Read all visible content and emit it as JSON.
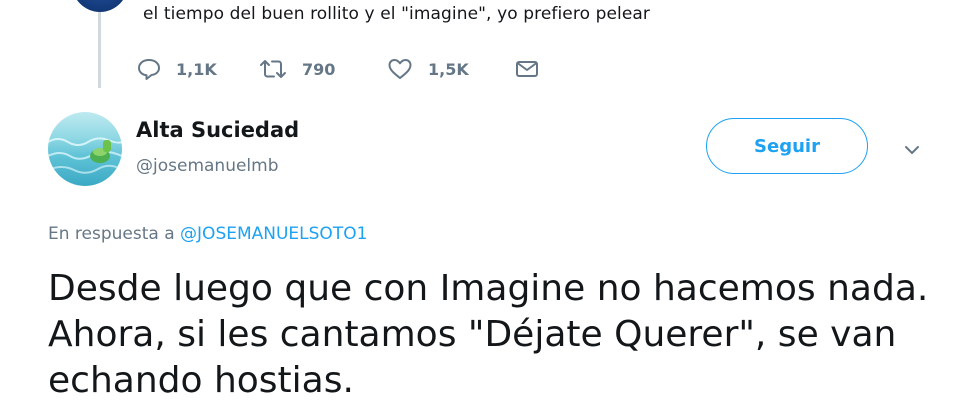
{
  "previous_tweet": {
    "text": "el tiempo del buen rollito y el \"imagine\", yo prefiero pelear",
    "actions": {
      "reply_count": "1,1K",
      "retweet_count": "790",
      "like_count": "1,5K"
    },
    "icons": [
      "reply-icon",
      "retweet-icon",
      "like-icon",
      "message-icon"
    ]
  },
  "tweet": {
    "author_name": "Alta Suciedad",
    "author_handle": "@josemanuelmb",
    "follow_label": "Seguir",
    "reply_prefix": "En respuesta a ",
    "reply_mention": "@JOSEMANUELSOTO1",
    "text": "Desde luego que con Imagine no hacemos nada. Ahora, si les cantamos \"Déjate Querer\", se van echando hostias."
  },
  "colors": {
    "accent": "#1da1f2",
    "muted": "#657786",
    "text": "#14171a",
    "thread_line": "#cfd9de"
  }
}
